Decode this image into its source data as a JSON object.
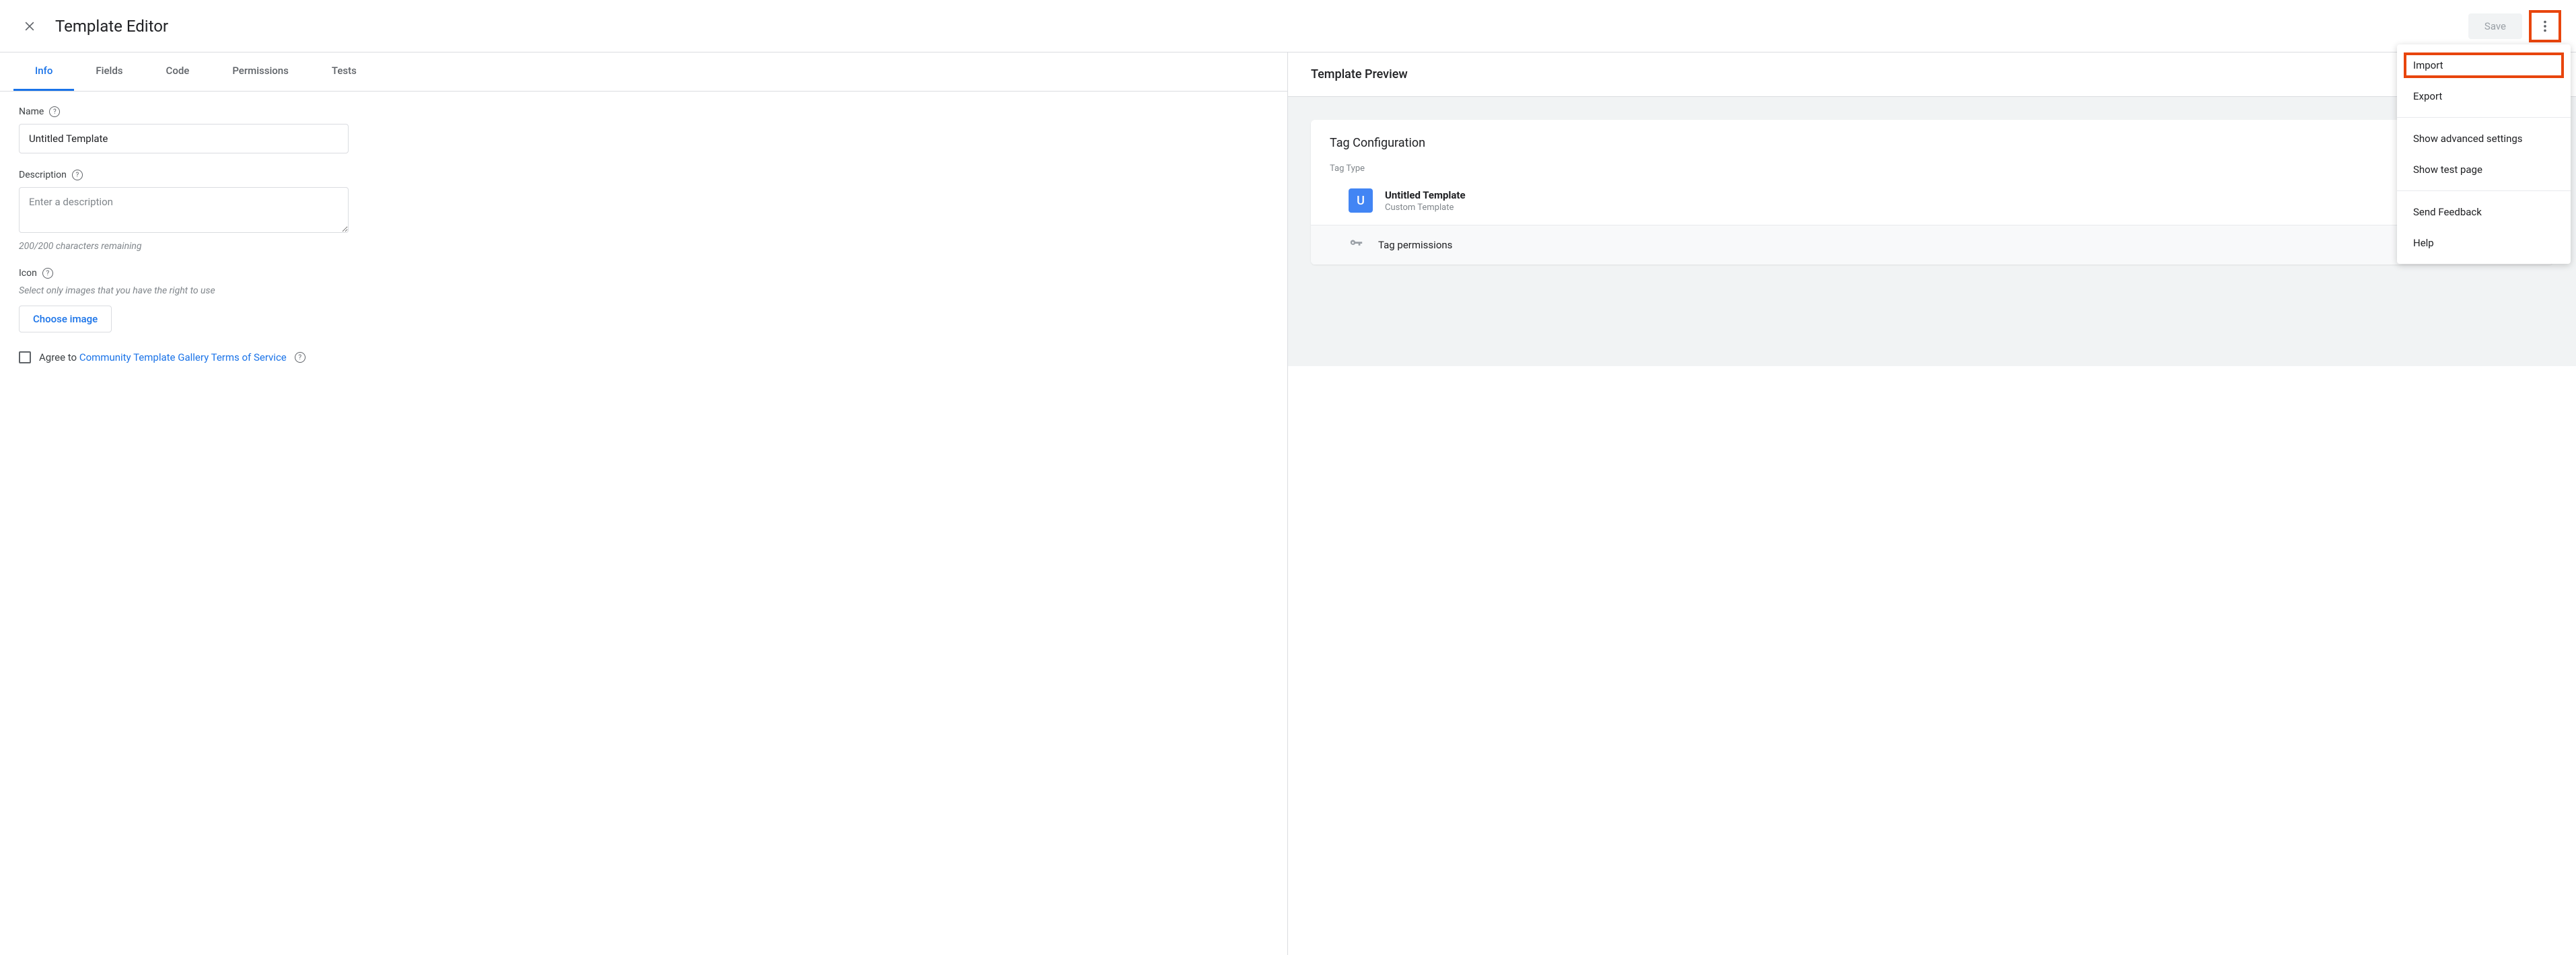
{
  "header": {
    "title": "Template Editor",
    "save_label": "Save"
  },
  "tabs": [
    "Info",
    "Fields",
    "Code",
    "Permissions",
    "Tests"
  ],
  "form": {
    "name_label": "Name",
    "name_value": "Untitled Template",
    "desc_label": "Description",
    "desc_placeholder": "Enter a description",
    "desc_counter": "200/200 characters remaining",
    "icon_label": "Icon",
    "icon_helper": "Select only images that you have the right to use",
    "choose_image_label": "Choose image",
    "agree_prefix": "Agree to ",
    "agree_link": "Community Template Gallery Terms of Service"
  },
  "preview": {
    "title": "Template Preview",
    "card_title": "Tag Configuration",
    "tag_type_label": "Tag Type",
    "tag_icon_letter": "U",
    "tag_name": "Untitled Template",
    "tag_sub": "Custom Template",
    "perm_label": "Tag permissions"
  },
  "menu": {
    "import": "Import",
    "export": "Export",
    "advanced": "Show advanced settings",
    "testpage": "Show test page",
    "feedback": "Send Feedback",
    "help": "Help"
  }
}
